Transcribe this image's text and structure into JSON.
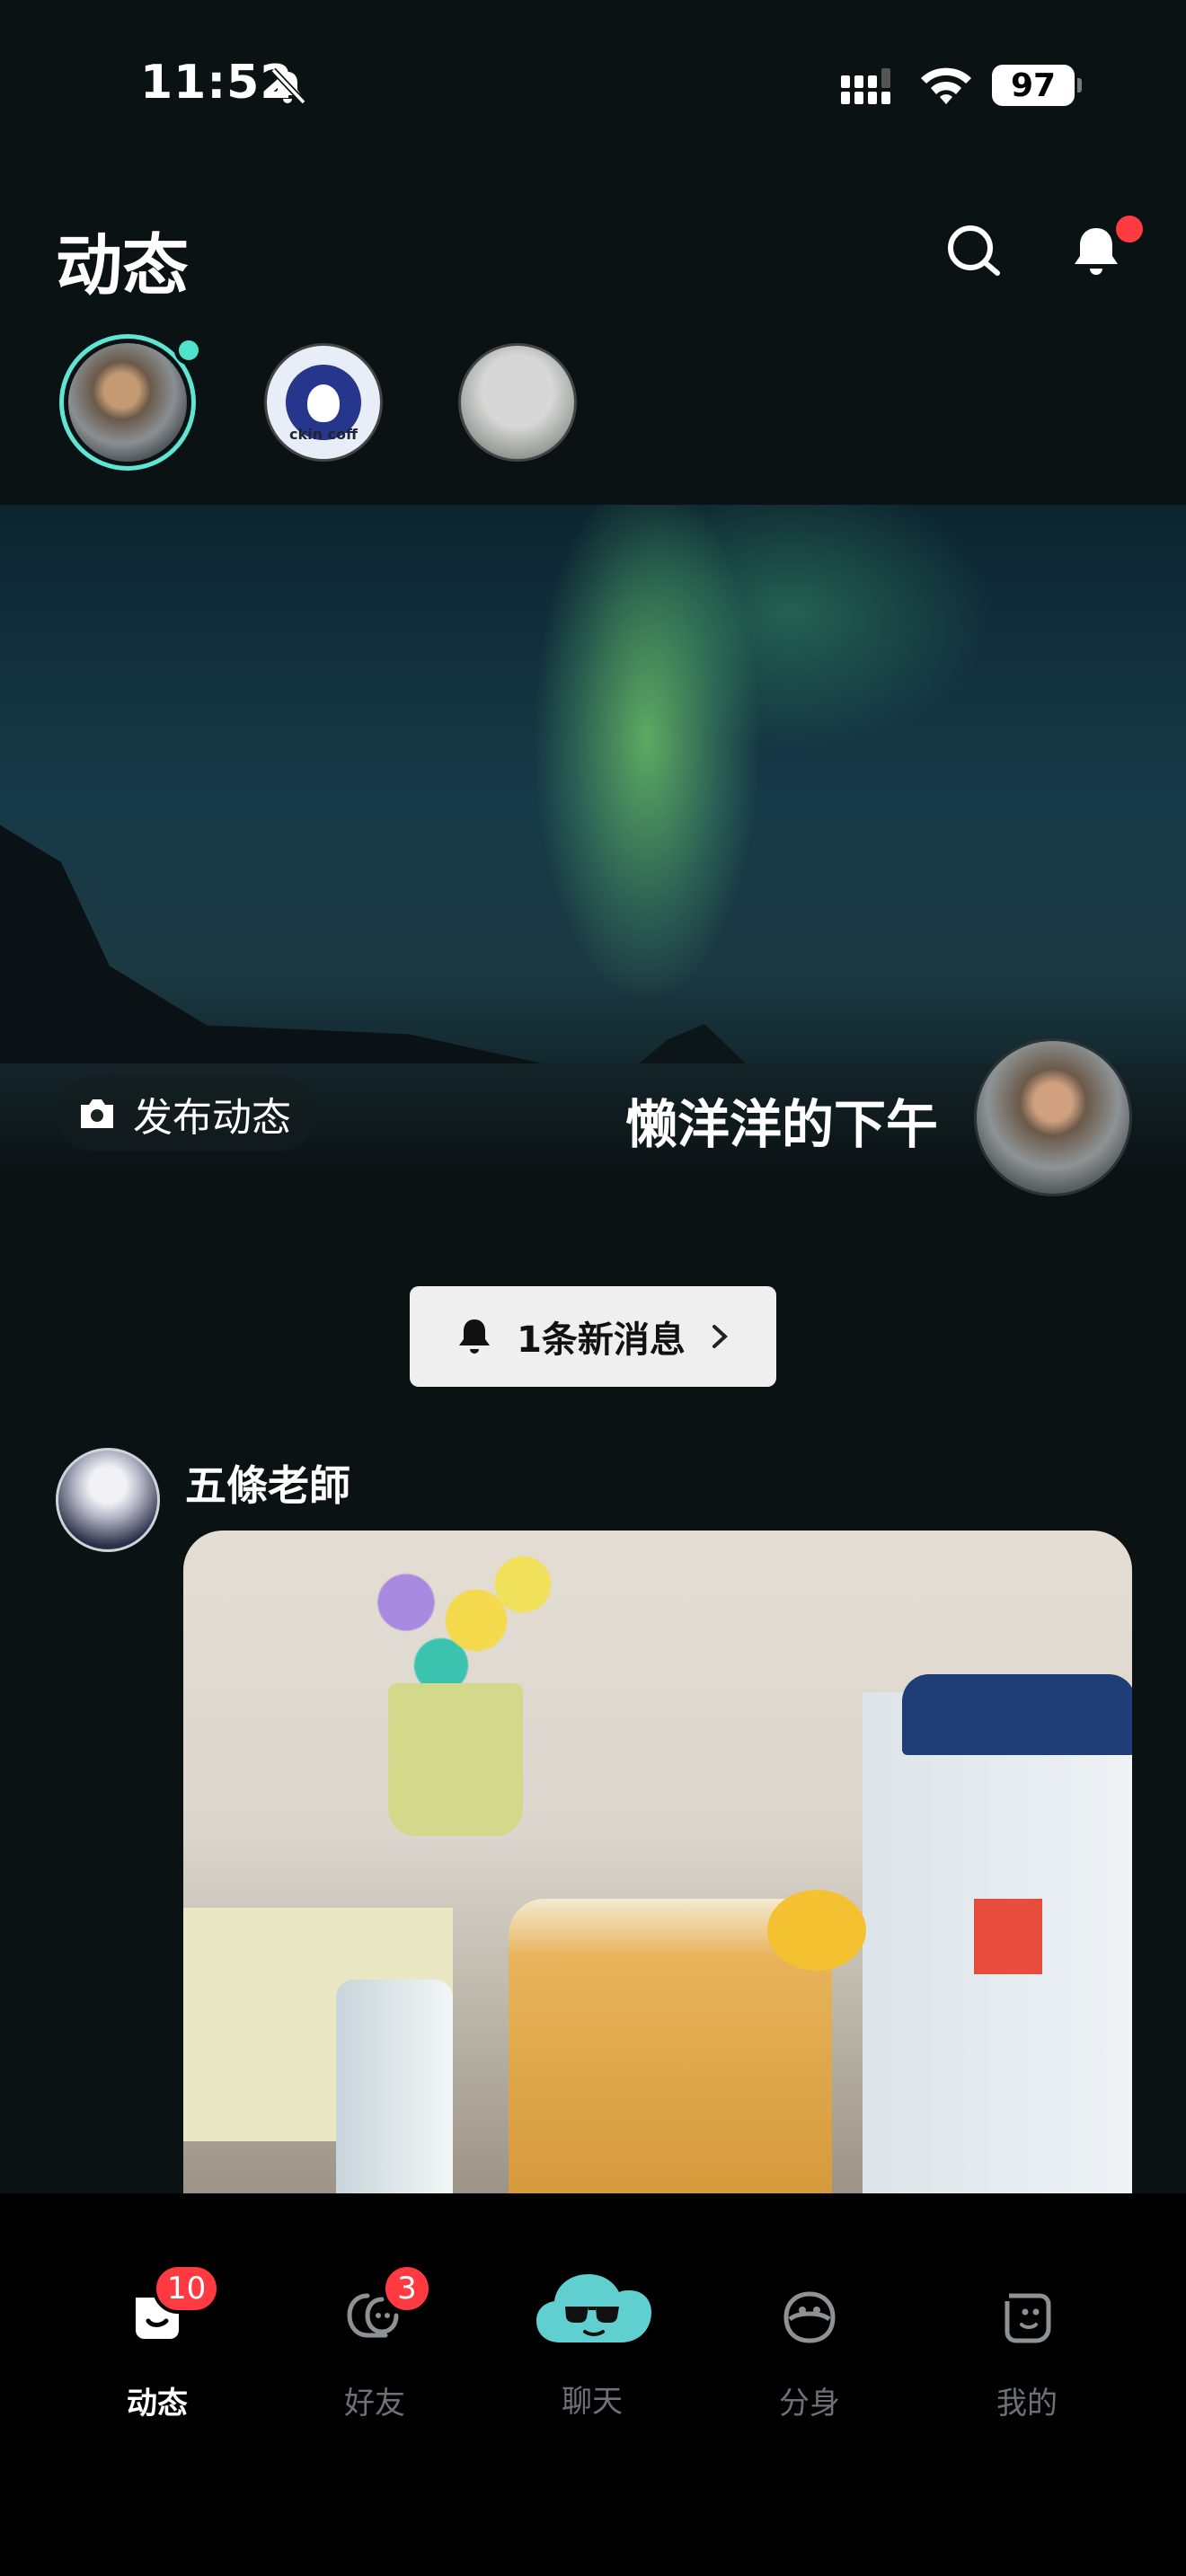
{
  "status_bar": {
    "time": "11:52",
    "battery": "97"
  },
  "header": {
    "title": "动态"
  },
  "stories": [
    {
      "name": "my-story",
      "active": true
    },
    {
      "name": "luckin-coffee-story",
      "label": "ckin coff"
    },
    {
      "name": "friend-story"
    }
  ],
  "hero": {
    "post_button_label": "发布动态",
    "user_name": "懒洋洋的下午"
  },
  "notifications": {
    "new_messages_label": "1条新消息"
  },
  "feed": {
    "posts": [
      {
        "author": "五條老師"
      }
    ]
  },
  "tabbar": {
    "items": [
      {
        "label": "动态",
        "badge": "10",
        "icon": "moments-icon"
      },
      {
        "label": "好友",
        "badge": "3",
        "icon": "friends-icon"
      },
      {
        "label": "聊天",
        "icon": "chat-cloud-icon"
      },
      {
        "label": "分身",
        "icon": "avatar-clone-icon"
      },
      {
        "label": "我的",
        "icon": "profile-icon"
      }
    ]
  },
  "colors": {
    "accent": "#4fe3cc",
    "badge": "#ff3b41",
    "background": "#0b1214"
  }
}
